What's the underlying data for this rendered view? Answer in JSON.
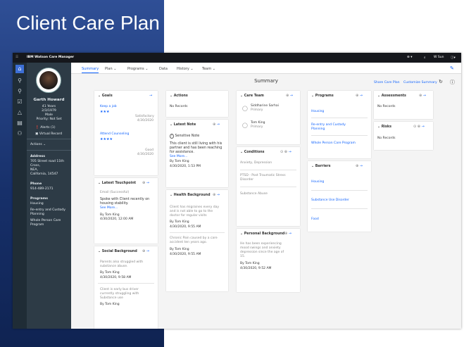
{
  "slide_title": "Client Care Plan",
  "app": {
    "product": "IBM Watson Care Manager",
    "user_short": "W Sun"
  },
  "client": {
    "name": "Garth Howard",
    "age": "41 Years",
    "dob": "2/3/1979",
    "gender": "Male",
    "priority": "Priority: Not Set",
    "alerts": "Alerts (1)",
    "virtual_record": "Virtual Record",
    "actions": "Actions",
    "address_label": "Address",
    "address": [
      "705 Street road 11th",
      "Cross,",
      "NEA,",
      "California, 14547"
    ],
    "phone_label": "Phone",
    "phone": "914-489-2171",
    "programs_label": "Programs",
    "programs": [
      "Housing",
      "Re-entry and Custody",
      "Planning",
      "Whole Person Care",
      "Program"
    ]
  },
  "tabs": [
    "Summary",
    "Plan",
    "Programs",
    "Data",
    "History",
    "Team"
  ],
  "main": {
    "summary_title": "Summary",
    "share_care_plan": "Share Care Plan",
    "customize_summary": "Customize Summary"
  },
  "goals": {
    "title": "Goals",
    "items": [
      {
        "name": "Keep a job",
        "stars": "★★★",
        "status": "Satisfactory",
        "date": "4/30/2020"
      },
      {
        "name": "Attend Counseling",
        "stars": "★★★★",
        "status": "Good",
        "date": "4/30/2020"
      }
    ]
  },
  "latest_touchpoint": {
    "title": "Latest Touchpoint",
    "type": "Email (Successful)",
    "text": [
      "Spoke with Client recently on",
      "housing stability."
    ],
    "see_more": "See More...",
    "by": "By Tom King",
    "date": "4/30/2020, 12:00 AM"
  },
  "social_background": {
    "title": "Social Background",
    "text1": [
      "Parents also struggled with",
      "substance abuse."
    ],
    "by1": "By Tom King",
    "date1": "4/30/2020, 9:58 AM",
    "text2": [
      "Client is early bus driver",
      "currently struggling with",
      "Substance use"
    ],
    "by2": "By Tom King"
  },
  "actions_card": {
    "title": "Actions",
    "empty": "No Records"
  },
  "latest_note": {
    "title": "Latest Note",
    "sensitive": "Sensitive Note",
    "text": [
      "This client is still living with his",
      "partner and has been reaching",
      "for assistance."
    ],
    "see_more": "See More...",
    "by": "By Tom King",
    "date": "4/30/2020, 1:53 PM"
  },
  "health_background": {
    "title": "Health Background",
    "text1": [
      "Client has migraines every day",
      "and is not able to go to the",
      "doctor for regular visits"
    ],
    "by1": "By Tom King",
    "date1": "4/30/2020, 9:55 AM",
    "text2": [
      "Chronic Pain caused by a care",
      "accident ten years ago."
    ],
    "by2": "By Tom King",
    "date2": "4/30/2020, 9:55 AM"
  },
  "care_team": {
    "title": "Care Team",
    "members": [
      {
        "name": "Siddharine Sarhai",
        "role": "Primary"
      },
      {
        "name": "Tom King",
        "role": "Primary"
      }
    ]
  },
  "conditions": {
    "title": "Conditions",
    "items": [
      "Anxiety, Depression",
      "PTSD - Post Traumatic Stress",
      "Disorder",
      "Substance Abuse"
    ]
  },
  "personal_background": {
    "title": "Personal Background",
    "text": [
      "He has been experiencing",
      "mood swings and anxiety",
      "depression since the age of",
      "15."
    ],
    "by": "By Tom King",
    "date": "4/30/2020, 9:52 AM"
  },
  "programs_card": {
    "title": "Programs",
    "items": [
      "Housing",
      "Re-entry and Custody",
      "Planning",
      "Whole Person Care Program"
    ]
  },
  "barriers": {
    "title": "Barriers",
    "items": [
      "Housing",
      "Substance Use Disorder",
      "Food"
    ]
  },
  "assessments": {
    "title": "Assessments",
    "empty": "No Records"
  },
  "risks": {
    "title": "Risks",
    "empty": "No Records"
  }
}
